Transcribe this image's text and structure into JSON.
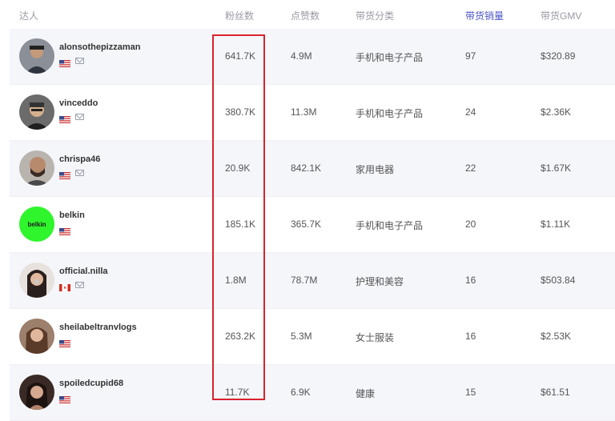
{
  "header": {
    "creator": "达人",
    "followers": "粉丝数",
    "likes": "点赞数",
    "category": "带货分类",
    "sales": "带货销量",
    "gmv": "带货GMV"
  },
  "rows": [
    {
      "username": "alonsothepizzaman",
      "country": "US",
      "followers": "641.7K",
      "likes": "4.9M",
      "category": "手机和电子产品",
      "sales": "97",
      "gmv": "$320.89"
    },
    {
      "username": "vinceddo",
      "country": "US",
      "followers": "380.7K",
      "likes": "11.3M",
      "category": "手机和电子产品",
      "sales": "24",
      "gmv": "$2.36K"
    },
    {
      "username": "chrispa46",
      "country": "US",
      "followers": "20.9K",
      "likes": "842.1K",
      "category": "家用电器",
      "sales": "22",
      "gmv": "$1.67K"
    },
    {
      "username": "belkin",
      "country": "US",
      "avatar_text": "belkin",
      "followers": "185.1K",
      "likes": "365.7K",
      "category": "手机和电子产品",
      "sales": "20",
      "gmv": "$1.11K"
    },
    {
      "username": "official.nilla",
      "country": "CA",
      "followers": "1.8M",
      "likes": "78.7M",
      "category": "护理和美容",
      "sales": "16",
      "gmv": "$503.84"
    },
    {
      "username": "sheilabeltranvlogs",
      "country": "US",
      "followers": "263.2K",
      "likes": "5.3M",
      "category": "女士服装",
      "sales": "16",
      "gmv": "$2.53K"
    },
    {
      "username": "spoiledcupid68",
      "country": "US",
      "followers": "11.7K",
      "likes": "6.9K",
      "category": "健康",
      "sales": "15",
      "gmv": "$61.51"
    }
  ],
  "colors": {
    "accent": "#4a55c7",
    "highlight_border": "#d9232e",
    "belkin_bg": "#2ff52c"
  }
}
